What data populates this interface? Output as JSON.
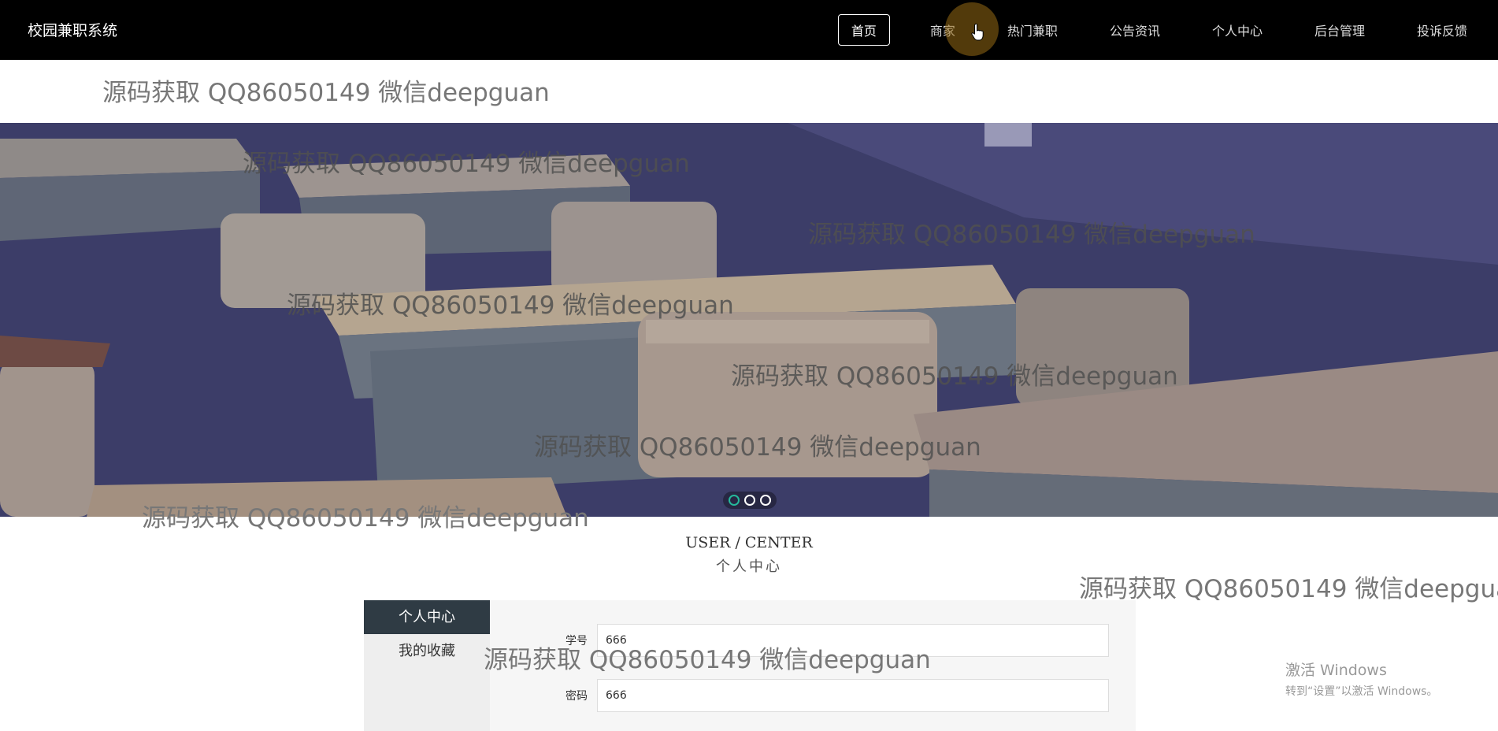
{
  "header": {
    "brand": "校园兼职系统",
    "nav": [
      {
        "label": "首页"
      },
      {
        "label": "商家"
      },
      {
        "label": "热门兼职"
      },
      {
        "label": "公告资讯"
      },
      {
        "label": "个人中心"
      },
      {
        "label": "后台管理"
      },
      {
        "label": "投诉反馈"
      }
    ],
    "active_index": 0
  },
  "watermark": "源码获取 QQ86050149 微信deepguan",
  "carousel": {
    "slide_count": 3,
    "active_slide": 1
  },
  "section": {
    "title_en": "USER / CENTER",
    "title_cn": "个人中心"
  },
  "sidebar": {
    "items": [
      {
        "label": "个人中心"
      },
      {
        "label": "我的收藏"
      }
    ]
  },
  "form": {
    "fields": [
      {
        "label": "学号",
        "value": "666"
      },
      {
        "label": "密码",
        "value": "666"
      }
    ]
  },
  "os_overlay": {
    "line1": "激活 Windows",
    "line2": "转到“设置”以激活 Windows。"
  },
  "colors": {
    "nav_bg": "#000000",
    "sidebar_active": "#2f3b44",
    "carousel_active": "#25b89b"
  }
}
